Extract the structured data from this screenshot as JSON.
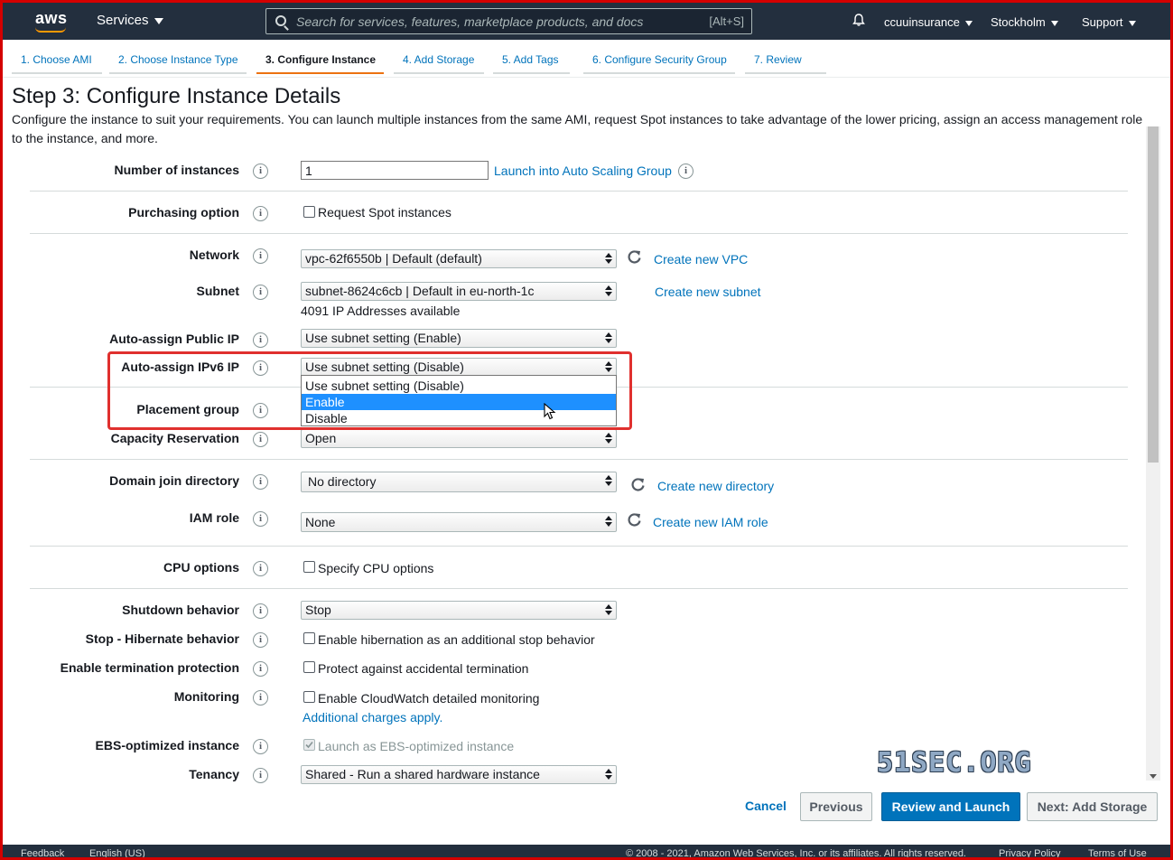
{
  "topnav": {
    "logo": "aws",
    "services_label": "Services",
    "search_placeholder": "Search for services, features, marketplace products, and docs",
    "search_shortcut": "[Alt+S]",
    "account": "ccuuinsurance",
    "region": "Stockholm",
    "support": "Support"
  },
  "wizard": {
    "steps": [
      {
        "label": "1. Choose AMI"
      },
      {
        "label": "2. Choose Instance Type"
      },
      {
        "label": "3. Configure Instance"
      },
      {
        "label": "4. Add Storage"
      },
      {
        "label": "5. Add Tags"
      },
      {
        "label": "6. Configure Security Group"
      },
      {
        "label": "7. Review"
      }
    ],
    "active_index": 2
  },
  "page": {
    "title": "Step 3: Configure Instance Details",
    "description": "Configure the instance to suit your requirements. You can launch multiple instances from the same AMI, request Spot instances to take advantage of the lower pricing, assign an access management role to the instance, and more."
  },
  "fields": {
    "num_instances": {
      "label": "Number of instances",
      "value": "1",
      "link": "Launch into Auto Scaling Group"
    },
    "purchasing": {
      "label": "Purchasing option",
      "checkbox": "Request Spot instances"
    },
    "network": {
      "label": "Network",
      "value": "vpc-62f6550b | Default (default)",
      "link": "Create new VPC"
    },
    "subnet": {
      "label": "Subnet",
      "value": "subnet-8624c6cb | Default in eu-north-1c",
      "link": "Create new subnet",
      "note": "4091 IP Addresses available"
    },
    "public_ip": {
      "label": "Auto-assign Public IP",
      "value": "Use subnet setting (Enable)"
    },
    "ipv6": {
      "label": "Auto-assign IPv6 IP",
      "value": "Use subnet setting (Disable)",
      "options": [
        "Use subnet setting (Disable)",
        "Enable",
        "Disable"
      ],
      "highlighted_option": "Enable"
    },
    "placement": {
      "label": "Placement group"
    },
    "capacity": {
      "label": "Capacity Reservation",
      "value": "Open"
    },
    "domain": {
      "label": "Domain join directory",
      "value": "No directory",
      "link": "Create new directory"
    },
    "iam": {
      "label": "IAM role",
      "value": "None",
      "link": "Create new IAM role"
    },
    "cpu": {
      "label": "CPU options",
      "checkbox": "Specify CPU options"
    },
    "shutdown": {
      "label": "Shutdown behavior",
      "value": "Stop"
    },
    "hibernate": {
      "label": "Stop - Hibernate behavior",
      "checkbox": "Enable hibernation as an additional stop behavior"
    },
    "termination": {
      "label": "Enable termination protection",
      "checkbox": "Protect against accidental termination"
    },
    "monitoring": {
      "label": "Monitoring",
      "checkbox": "Enable CloudWatch detailed monitoring",
      "link": "Additional charges apply."
    },
    "ebs": {
      "label": "EBS-optimized instance",
      "checkbox": "Launch as EBS-optimized instance"
    },
    "tenancy": {
      "label": "Tenancy",
      "value": "Shared - Run a shared hardware instance"
    }
  },
  "buttons": {
    "cancel": "Cancel",
    "previous": "Previous",
    "review": "Review and Launch",
    "next": "Next: Add Storage"
  },
  "footer": {
    "feedback": "Feedback",
    "language": "English (US)",
    "copyright": "© 2008 - 2021, Amazon Web Services, Inc. or its affiliates. All rights reserved.",
    "privacy": "Privacy Policy",
    "terms": "Terms of Use"
  },
  "watermark": "51SEC.ORG",
  "colors": {
    "nav_bg": "#232f3e",
    "accent": "#ec7211",
    "link": "#0073bb",
    "primary_button": "#0073bb",
    "highlight": "#e0302e",
    "dropdown_selected": "#1e90ff"
  }
}
